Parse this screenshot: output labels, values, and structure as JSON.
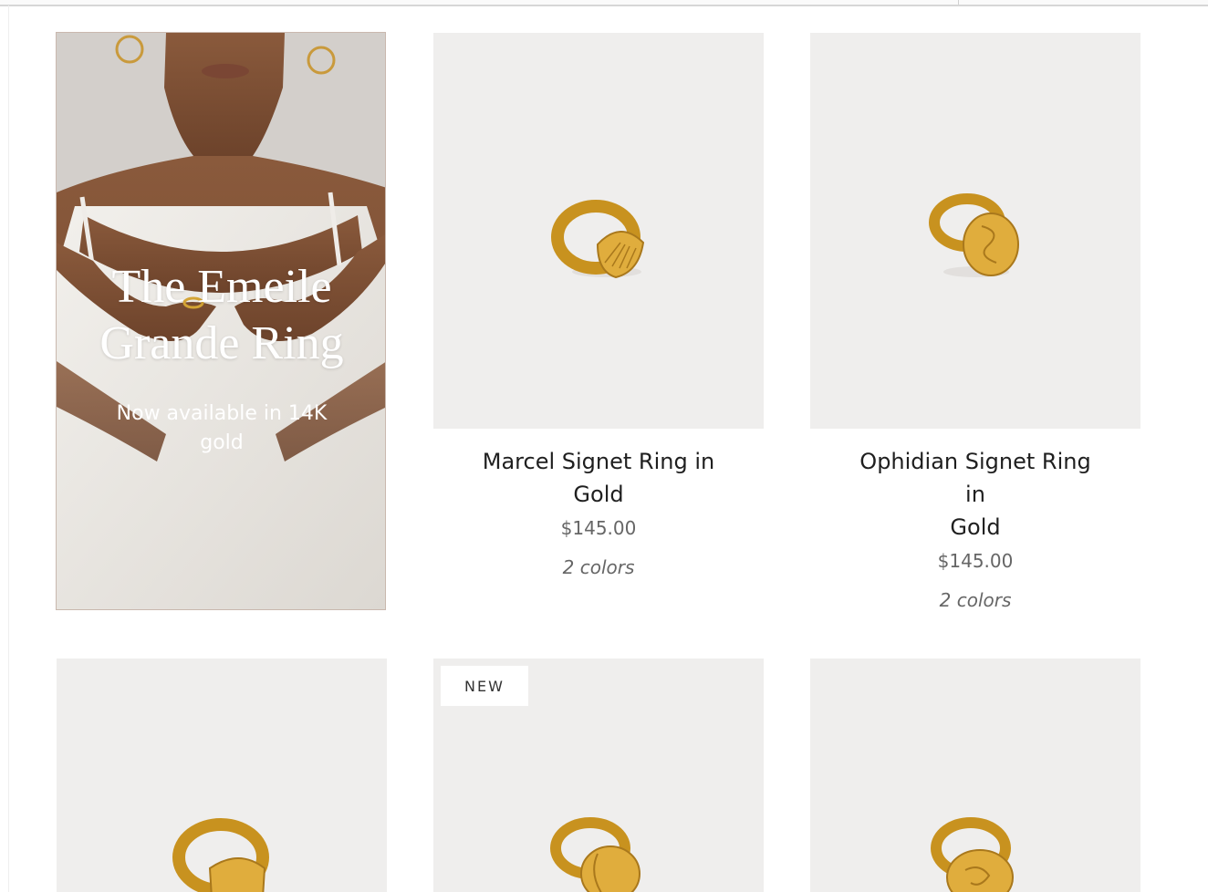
{
  "promo": {
    "title_line1": "The Emeile",
    "title_line2": "Grande Ring",
    "subtitle_line1": "Now available in 14K",
    "subtitle_line2": "gold"
  },
  "products": [
    {
      "name_line1": "Marcel Signet Ring in",
      "name_line2": "Gold",
      "price": "$145.00",
      "colors": "2 colors"
    },
    {
      "name_line1": "Ophidian Signet Ring in",
      "name_line2": "Gold",
      "price": "$145.00",
      "colors": "2 colors"
    }
  ],
  "second_row": {
    "badge": "NEW"
  },
  "colors": {
    "tile_background": "#efeeed",
    "gold": "#d4a435",
    "gold_dark": "#a9781c",
    "text_primary": "#1f1f1f",
    "text_muted": "#666666"
  }
}
